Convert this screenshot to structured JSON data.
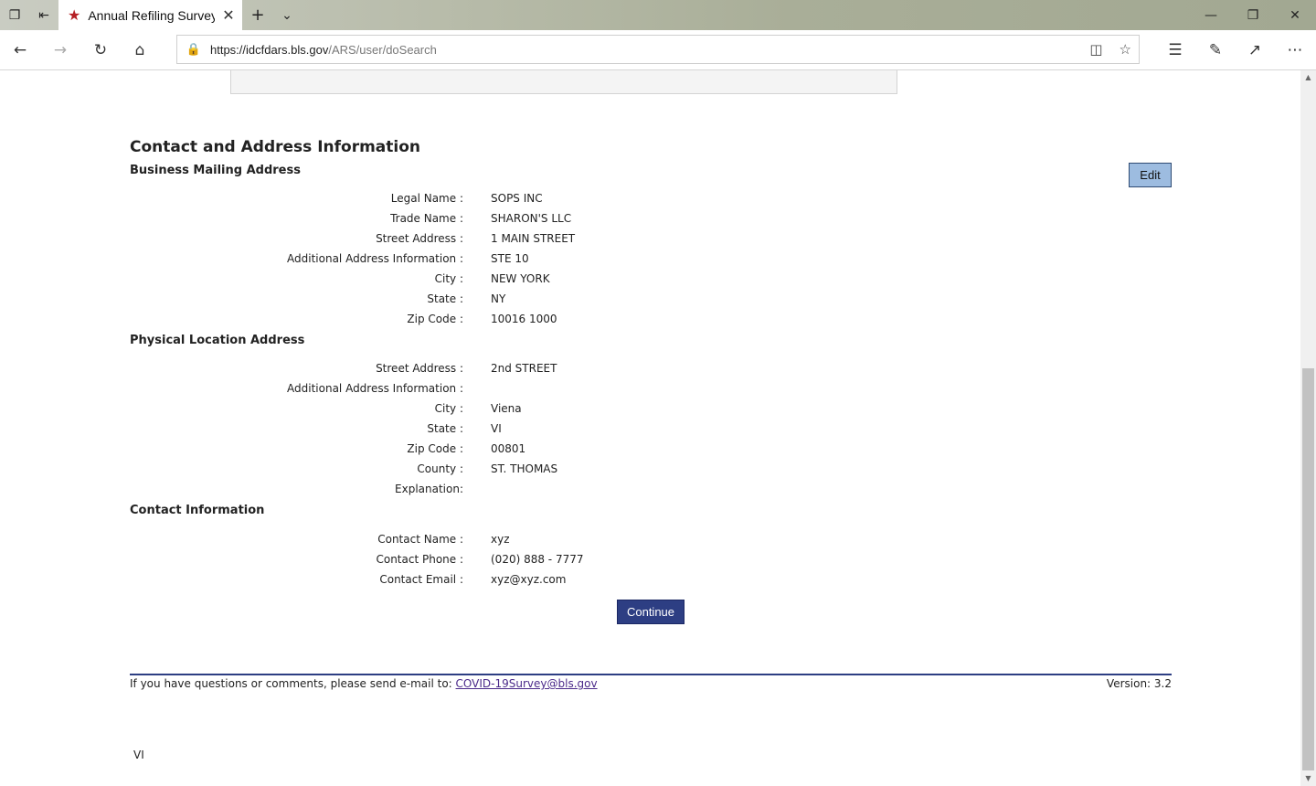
{
  "browser": {
    "tab_title": "Annual Refiling Survey -",
    "url_host": "https://idcfdars.bls.gov",
    "url_path": "/ARS/user/doSearch"
  },
  "page": {
    "section_title": "Contact and Address Information",
    "edit_label": "Edit",
    "business": {
      "title": "Business Mailing Address",
      "rows": [
        {
          "label": "Legal Name :",
          "value": "SOPS INC"
        },
        {
          "label": "Trade Name :",
          "value": "SHARON'S LLC"
        },
        {
          "label": "Street Address :",
          "value": "1 MAIN STREET"
        },
        {
          "label": "Additional Address Information :",
          "value": "STE 10"
        },
        {
          "label": "City :",
          "value": "NEW YORK"
        },
        {
          "label": "State :",
          "value": "NY"
        },
        {
          "label": "Zip Code :",
          "value": "10016 1000"
        }
      ]
    },
    "physical": {
      "title": "Physical Location Address",
      "rows": [
        {
          "label": "Street Address :",
          "value": "2nd STREET"
        },
        {
          "label": "Additional Address Information :",
          "value": ""
        },
        {
          "label": "City :",
          "value": "Viena"
        },
        {
          "label": "State :",
          "value": "VI"
        },
        {
          "label": "Zip Code :",
          "value": "00801"
        },
        {
          "label": "County :",
          "value": "ST. THOMAS"
        },
        {
          "label": "Explanation:",
          "value": ""
        }
      ]
    },
    "contact": {
      "title": "Contact Information",
      "rows": [
        {
          "label": "Contact Name :",
          "value": "xyz"
        },
        {
          "label": "Contact Phone :",
          "value": "(020) 888 - 7777"
        },
        {
          "label": "Contact Email :",
          "value": "xyz@xyz.com"
        }
      ]
    },
    "continue_label": "Continue",
    "footer": {
      "text": "If you have questions or comments, please send e-mail to: ",
      "email": "COVID-19Survey@bls.gov",
      "version": "Version: 3.2"
    },
    "bottom_text": "VI"
  },
  "colors": {
    "button_navy": "#2d3e83",
    "edit_blue": "#9dbce0"
  }
}
